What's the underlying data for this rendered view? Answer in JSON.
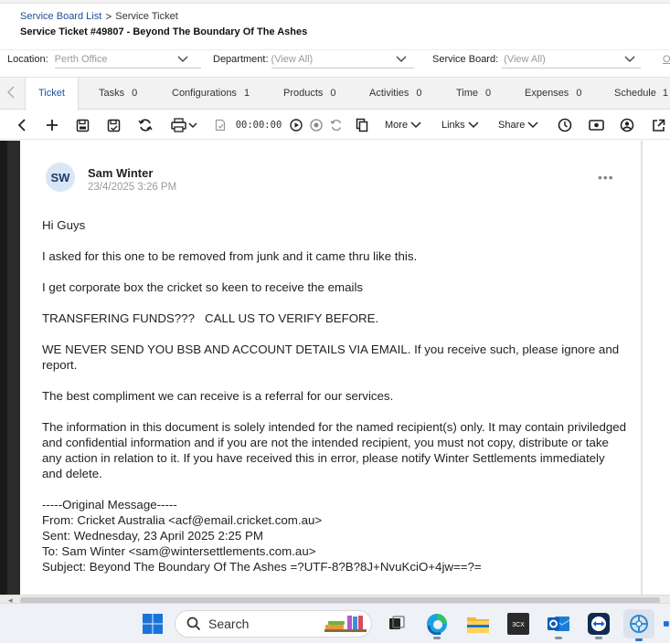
{
  "breadcrumb": {
    "parent": "Service Board List",
    "separator": ">",
    "current": "Service Ticket"
  },
  "page_title": "Service Ticket #49807 - Beyond The Boundary Of The Ashes",
  "filters": {
    "location": {
      "label": "Location:",
      "value": "Perth Office"
    },
    "department": {
      "label": "Department:",
      "value": "(View All)"
    },
    "service_board": {
      "label": "Service Board:",
      "value": "(View All)"
    },
    "overflow": "Or"
  },
  "tabs": [
    {
      "label": "Ticket",
      "count": ""
    },
    {
      "label": "Tasks",
      "count": "0"
    },
    {
      "label": "Configurations",
      "count": "1"
    },
    {
      "label": "Products",
      "count": "0"
    },
    {
      "label": "Activities",
      "count": "0"
    },
    {
      "label": "Time",
      "count": "0"
    },
    {
      "label": "Expenses",
      "count": "0"
    },
    {
      "label": "Schedule",
      "count": "1"
    }
  ],
  "toolbar": {
    "timer": "00:00:00",
    "more_label": "More",
    "links_label": "Links",
    "share_label": "Share"
  },
  "note": {
    "avatar_initials": "SW",
    "author": "Sam Winter",
    "timestamp": "23/4/2025 3:26 PM",
    "paragraphs": [
      "Hi Guys",
      "I asked for this one to be removed from junk and it came thru like this.",
      "I get corporate box the cricket so keen to receive the emails",
      "TRANSFERING FUNDS???   CALL US TO VERIFY BEFORE.",
      "WE NEVER SEND YOU BSB AND ACCOUNT DETAILS VIA EMAIL. If you receive such, please ignore and report.",
      "The best compliment we can receive is a referral for our services.",
      "The information in this document is solely intended for the named recipient(s) only. It may contain priviledged and confidential information and if you are not the intended recipient, you must not copy, distribute or take any action in relation to it. If you have received this in error, please notify Winter Settlements immediately and delete."
    ],
    "original_message": [
      "-----Original Message-----",
      "From: Cricket Australia <acf@email.cricket.com.au>",
      "Sent: Wednesday, 23 April 2025 2:25 PM",
      "To: Sam Winter <sam@wintersettlements.com.au>",
      "Subject: Beyond The Boundary Of The Ashes =?UTF-8?B?8J+NvuKciO+4jw==?="
    ]
  },
  "taskbar": {
    "search_label": "Search"
  },
  "colors": {
    "link": "#1f4e9c",
    "avatar_bg": "#d9e6f5",
    "taskbar_bg": "#eef1f6"
  }
}
